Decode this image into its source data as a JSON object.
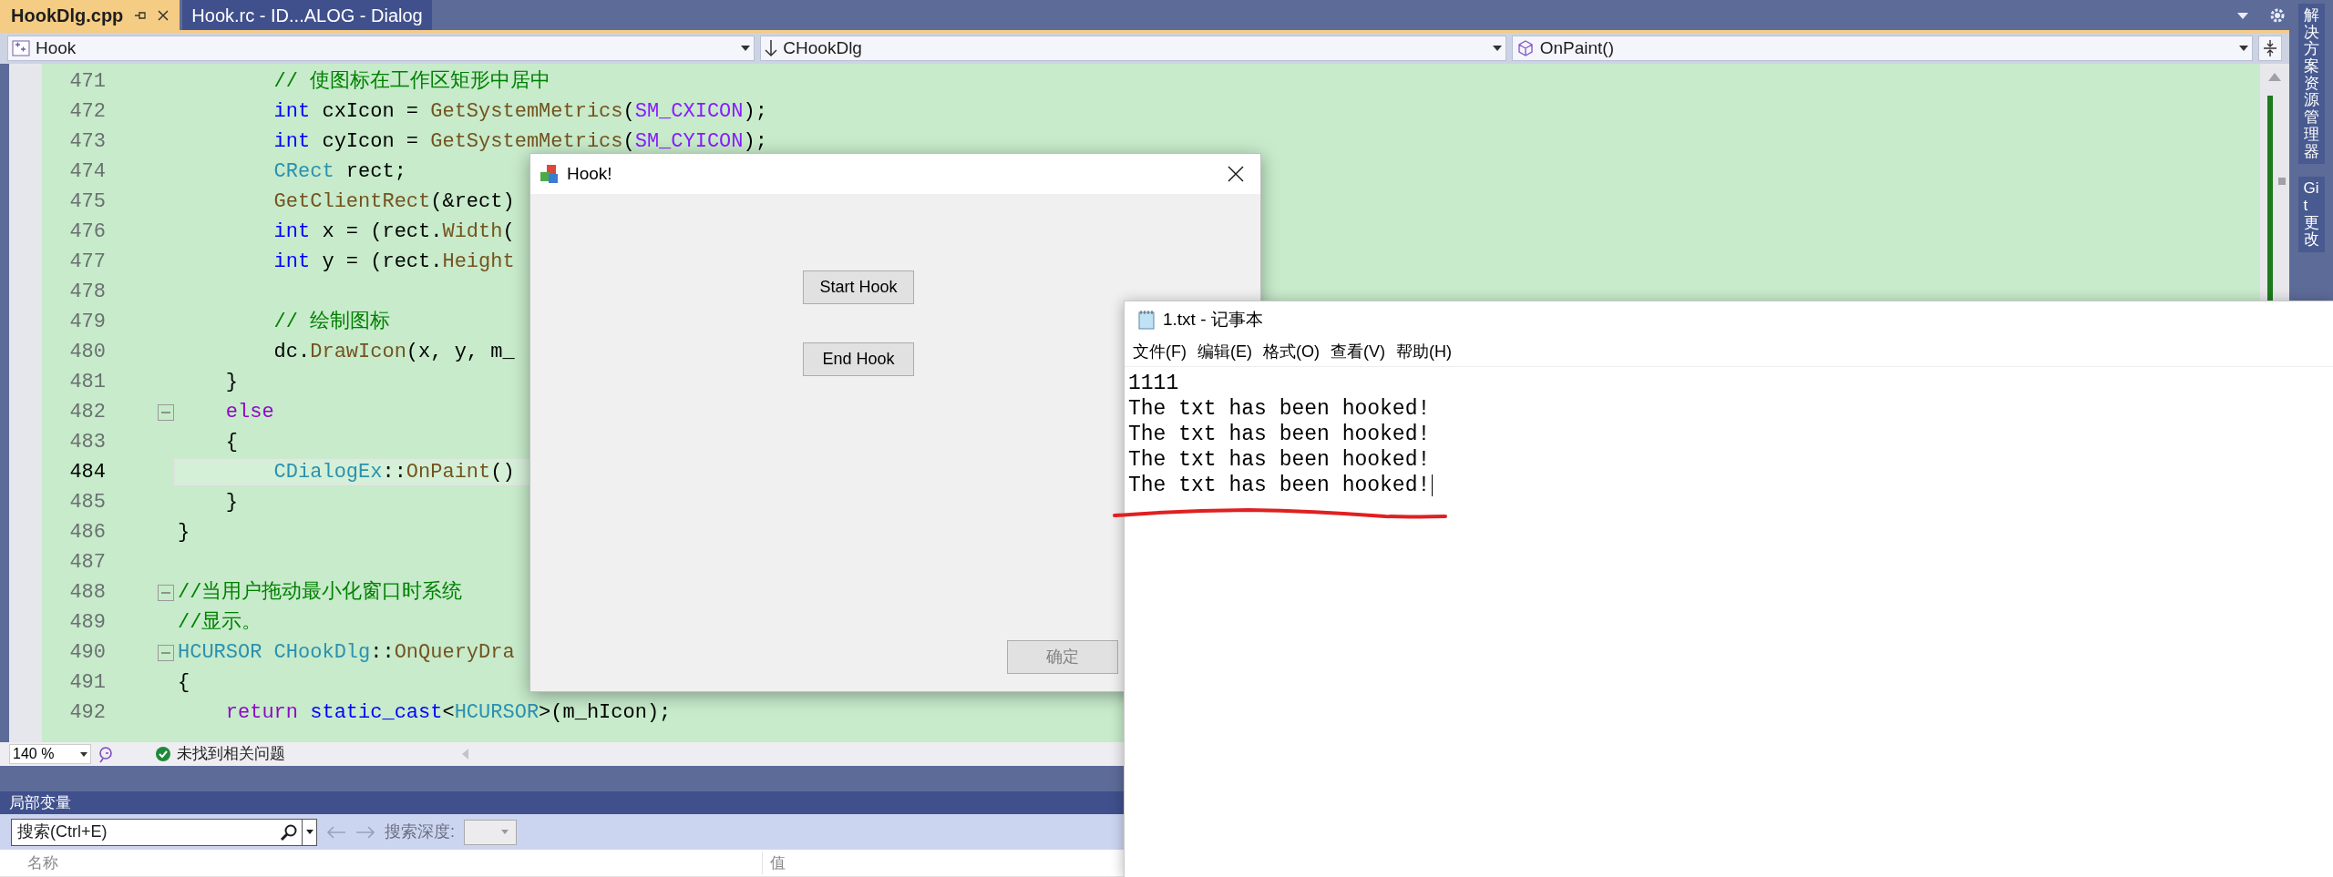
{
  "tabs": [
    {
      "label": "HookDlg.cpp",
      "selected": true
    },
    {
      "label": "Hook.rc - ID...ALOG - Dialog",
      "selected": false
    }
  ],
  "navigation": {
    "project": "Hook",
    "class": "CHookDlg",
    "member": "OnPaint()"
  },
  "side_panels": [
    "解决方案资源管理器",
    "Git 更改"
  ],
  "editor": {
    "lines": [
      {
        "number": "471",
        "current": false,
        "fold": false,
        "tokens": [
          {
            "kind": "comment",
            "text": "        // 使图标在工作区矩形中居中"
          }
        ]
      },
      {
        "number": "472",
        "current": false,
        "fold": false,
        "tokens": [
          {
            "kind": "keyword",
            "text": "        int"
          },
          {
            "kind": "plain",
            "text": " cxIcon = "
          },
          {
            "kind": "function",
            "text": "GetSystemMetrics"
          },
          {
            "kind": "plain",
            "text": "("
          },
          {
            "kind": "macro",
            "text": "SM_CXICON"
          },
          {
            "kind": "plain",
            "text": ");"
          }
        ]
      },
      {
        "number": "473",
        "current": false,
        "fold": false,
        "tokens": [
          {
            "kind": "keyword",
            "text": "        int"
          },
          {
            "kind": "plain",
            "text": " cyIcon = "
          },
          {
            "kind": "function",
            "text": "GetSystemMetrics"
          },
          {
            "kind": "plain",
            "text": "("
          },
          {
            "kind": "macro",
            "text": "SM_CYICON"
          },
          {
            "kind": "plain",
            "text": ");"
          }
        ]
      },
      {
        "number": "474",
        "current": false,
        "fold": false,
        "tokens": [
          {
            "kind": "type",
            "text": "        CRect"
          },
          {
            "kind": "plain",
            "text": " rect;"
          }
        ]
      },
      {
        "number": "475",
        "current": false,
        "fold": false,
        "tokens": [
          {
            "kind": "function",
            "text": "        GetClientRect"
          },
          {
            "kind": "plain",
            "text": "(&rect)"
          }
        ]
      },
      {
        "number": "476",
        "current": false,
        "fold": false,
        "tokens": [
          {
            "kind": "keyword",
            "text": "        int"
          },
          {
            "kind": "plain",
            "text": " x = (rect."
          },
          {
            "kind": "function",
            "text": "Width"
          },
          {
            "kind": "plain",
            "text": "("
          }
        ]
      },
      {
        "number": "477",
        "current": false,
        "fold": false,
        "tokens": [
          {
            "kind": "keyword",
            "text": "        int"
          },
          {
            "kind": "plain",
            "text": " y = (rect."
          },
          {
            "kind": "function",
            "text": "Height"
          }
        ]
      },
      {
        "number": "478",
        "current": false,
        "fold": false
      },
      {
        "number": "479",
        "current": false,
        "fold": false,
        "tokens": [
          {
            "kind": "comment",
            "text": "        // 绘制图标"
          }
        ]
      },
      {
        "number": "480",
        "current": false,
        "fold": false,
        "tokens": [
          {
            "kind": "plain",
            "text": "        dc."
          },
          {
            "kind": "function",
            "text": "DrawIcon"
          },
          {
            "kind": "plain",
            "text": "(x, y, m_"
          }
        ]
      },
      {
        "number": "481",
        "current": false,
        "fold": false,
        "tokens": [
          {
            "kind": "plain",
            "text": "    }"
          }
        ]
      },
      {
        "number": "482",
        "current": false,
        "fold": true,
        "tokens": [
          {
            "kind": "control",
            "text": "    else"
          }
        ]
      },
      {
        "number": "483",
        "current": false,
        "fold": false,
        "tokens": [
          {
            "kind": "plain",
            "text": "    {"
          }
        ]
      },
      {
        "number": "484",
        "current": true,
        "fold": false,
        "tokens": [
          {
            "kind": "type",
            "text": "        CDialogEx"
          },
          {
            "kind": "plain",
            "text": "::"
          },
          {
            "kind": "function",
            "text": "OnPaint"
          },
          {
            "kind": "plain",
            "text": "()"
          }
        ]
      },
      {
        "number": "485",
        "current": false,
        "fold": false,
        "tokens": [
          {
            "kind": "plain",
            "text": "    }"
          }
        ]
      },
      {
        "number": "486",
        "current": false,
        "fold": false,
        "tokens": [
          {
            "kind": "plain",
            "text": "}"
          }
        ]
      },
      {
        "number": "487",
        "current": false,
        "fold": false
      },
      {
        "number": "488",
        "current": false,
        "fold": true,
        "tokens": [
          {
            "kind": "comment",
            "text": "//当用户拖动最小化窗口时系统"
          }
        ]
      },
      {
        "number": "489",
        "current": false,
        "fold": false,
        "tokens": [
          {
            "kind": "comment",
            "text": "//显示。"
          }
        ]
      },
      {
        "number": "490",
        "current": false,
        "fold": true,
        "tokens": [
          {
            "kind": "type",
            "text": "HCURSOR CHookDlg"
          },
          {
            "kind": "plain",
            "text": "::"
          },
          {
            "kind": "function",
            "text": "OnQueryDra"
          }
        ]
      },
      {
        "number": "491",
        "current": false,
        "fold": false,
        "tokens": [
          {
            "kind": "plain",
            "text": "{"
          }
        ]
      },
      {
        "number": "492",
        "current": false,
        "fold": false,
        "tokens": [
          {
            "kind": "control",
            "text": "    return"
          },
          {
            "kind": "keyword",
            "text": " static_cast"
          },
          {
            "kind": "plain",
            "text": "<"
          },
          {
            "kind": "type",
            "text": "HCURSOR"
          },
          {
            "kind": "plain",
            "text": ">(m_hIcon);"
          }
        ]
      }
    ]
  },
  "status_bar": {
    "zoom": "140 %",
    "issues": "未找到相关问题"
  },
  "locals": {
    "title": "局部变量",
    "search": {
      "placeholder": "搜索(Ctrl+E)"
    },
    "depth_label": "搜索深度:",
    "columns": [
      "名称",
      "值"
    ]
  },
  "dialog": {
    "title": "Hook!",
    "buttons": [
      {
        "label": "Start Hook",
        "disabled": false
      },
      {
        "label": "End Hook",
        "disabled": false
      },
      {
        "label": "确定",
        "disabled": true
      }
    ]
  },
  "notepad": {
    "title": "1.txt - 记事本",
    "menu": [
      "文件(F)",
      "编辑(E)",
      "格式(O)",
      "查看(V)",
      "帮助(H)"
    ],
    "lines": [
      "1111",
      "The txt has been hooked!",
      "The txt has been hooked!",
      "The txt has been hooked!",
      "The txt has been hooked!"
    ]
  }
}
